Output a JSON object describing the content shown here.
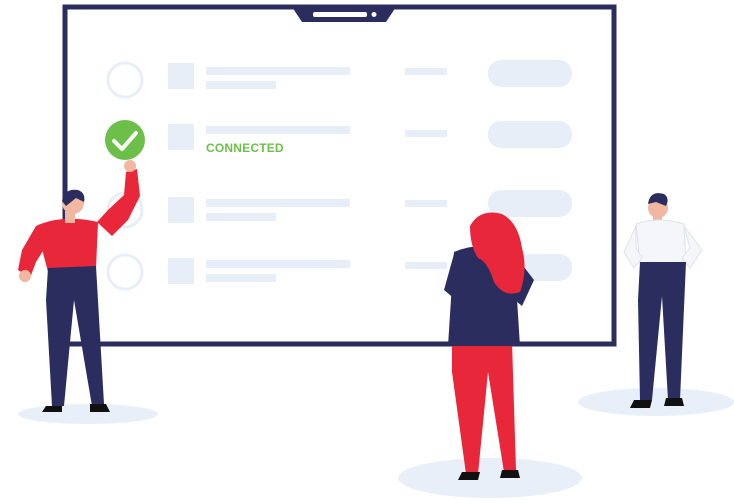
{
  "monitor": {
    "rows": [
      {
        "state": "unchecked",
        "status": ""
      },
      {
        "state": "checked",
        "status": "CONNECTED"
      },
      {
        "state": "unchecked",
        "status": ""
      },
      {
        "state": "unchecked",
        "status": ""
      }
    ]
  },
  "colors": {
    "frame": "#2b2d5e",
    "screen": "#ffffff",
    "placeholder": "#e8eef7",
    "check_green": "#6cc04a",
    "red": "#e8283a",
    "navy": "#2b2d5e",
    "shadow": "#e9eff8"
  },
  "people": [
    {
      "role": "man-pointing",
      "icon": "person-illustration"
    },
    {
      "role": "woman-red-hair",
      "icon": "person-illustration"
    },
    {
      "role": "man-white-shirt",
      "icon": "person-illustration"
    }
  ]
}
